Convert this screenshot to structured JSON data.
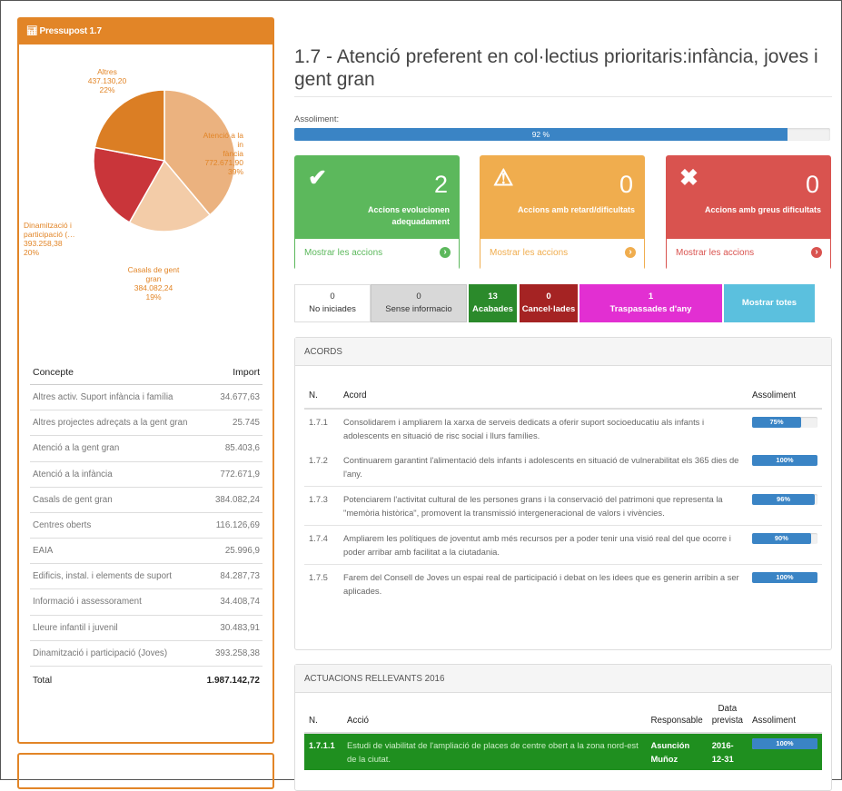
{
  "left_panel": {
    "header_icon": "bar-chart-icon",
    "header_title": "Pressupost 1.7",
    "colors": {
      "accent": "#e28527"
    },
    "pie_labels": [
      {
        "lines": [
          "Altres",
          "437.130,20",
          "22%"
        ]
      },
      {
        "lines": [
          "Atenció a la",
          "in",
          "fància",
          "772.671,90",
          "39%"
        ]
      },
      {
        "lines": [
          "Casals de gent",
          "gran",
          "384.082,24",
          "19%"
        ]
      },
      {
        "lines": [
          "Dinamització i",
          "participació (…",
          "393.258,38",
          "20%"
        ]
      }
    ],
    "table": {
      "col_concept": "Concepte",
      "col_import": "Import",
      "rows": [
        {
          "concept": "Altres activ. Suport infància i família",
          "import": "34.677,63"
        },
        {
          "concept": "Altres projectes adreçats a la gent gran",
          "import": "25.745"
        },
        {
          "concept": "Atenció a la gent gran",
          "import": "85.403,6"
        },
        {
          "concept": "Atenció a la infància",
          "import": "772.671,9"
        },
        {
          "concept": "Casals de gent gran",
          "import": "384.082,24"
        },
        {
          "concept": "Centres oberts",
          "import": "116.126,69"
        },
        {
          "concept": "EAIA",
          "import": "25.996,9"
        },
        {
          "concept": "Edificis, instal. i elements de suport",
          "import": "84.287,73"
        },
        {
          "concept": "Informació i assessorament",
          "import": "34.408,74"
        },
        {
          "concept": "Lleure infantil i juvenil",
          "import": "30.483,91"
        },
        {
          "concept": "Dinamització i participació (Joves)",
          "import": "393.258,38"
        }
      ],
      "total_label": "Total",
      "total_value": "1.987.142,72"
    }
  },
  "chart_data": {
    "type": "pie",
    "categories": [
      "Atenció a la infància",
      "Casals de gent gran",
      "Dinamització i participació (…)",
      "Altres"
    ],
    "values": [
      772671.9,
      384082.24,
      393258.38,
      437130.2
    ],
    "percent_labels": [
      "39%",
      "19%",
      "20%",
      "22%"
    ],
    "colors": [
      "#ebb27f",
      "#f3cca8",
      "#c9353a",
      "#db7e24"
    ]
  },
  "main": {
    "title": "1.7 - Atenció preferent en col·lectius prioritaris:infància, joves i gent gran",
    "assoliment_label": "Assoliment:",
    "assoliment_percent": 92,
    "assoliment_text": "92 %",
    "cards": [
      {
        "icon": "check-icon",
        "count": "2",
        "text": "Accions evolucionen adequadament",
        "link": "Mostrar les accions"
      },
      {
        "icon": "warning-icon",
        "count": "0",
        "text": "Accions amb retard/dificultats",
        "link": "Mostrar les accions"
      },
      {
        "icon": "close-icon",
        "count": "0",
        "text": "Accions amb greus dificultats",
        "link": "Mostrar les accions"
      }
    ],
    "filters": [
      {
        "count": "0",
        "label": "No iniciades"
      },
      {
        "count": "0",
        "label": "Sense informacio"
      },
      {
        "count": "13",
        "label": "Acabades"
      },
      {
        "count": "0",
        "label": "Cancel·lades"
      },
      {
        "count": "1",
        "label": "Traspassades d'any"
      },
      {
        "label": "Mostrar totes"
      }
    ],
    "acords": {
      "title": "ACORDS",
      "col_n": "N.",
      "col_acord": "Acord",
      "col_assoliment": "Assoliment",
      "rows": [
        {
          "n": "1.7.1",
          "text": "Consolidarem i ampliarem la xarxa de serveis dedicats a oferir suport socioeducatiu als infants i adolescents en situació de risc social i llurs famílies.",
          "percent": 75,
          "label": "75%"
        },
        {
          "n": "1.7.2",
          "text": "Continuarem garantint l'alimentació dels infants i adolescents en situació de vulnerabilitat els 365 dies de l'any.",
          "percent": 100,
          "label": "100%"
        },
        {
          "n": "1.7.3",
          "text": "Potenciarem l'activitat cultural de les persones grans i la conservació del patrimoni que representa la \"memòria històrica\", promovent la transmissió intergeneracional de valors i vivències.",
          "percent": 96,
          "label": "96%"
        },
        {
          "n": "1.7.4",
          "text": "Ampliarem les polítiques de joventut amb més recursos per a poder tenir una visió real del que ocorre i poder arribar amb facilitat a la ciutadania.",
          "percent": 90,
          "label": "90%"
        },
        {
          "n": "1.7.5",
          "text": "Farem del Consell de Joves un espai real de participació i debat on les idees que es generin arribin a ser aplicades.",
          "percent": 100,
          "label": "100%"
        }
      ]
    },
    "actuacions": {
      "title": "ACTUACIONS RELLEVANTS 2016",
      "col_n": "N.",
      "col_accio": "Acció",
      "col_responsable": "Responsable",
      "col_data": "Data prevista",
      "col_assoliment": "Assoliment",
      "rows": [
        {
          "n": "1.7.1.1",
          "text": "Estudi de viabilitat de l'ampliació de places de centre obert a la zona nord-est de la ciutat.",
          "responsable": "Asunción Muñoz",
          "data": "2016-12-31",
          "percent": 100,
          "label": "100%"
        }
      ]
    }
  }
}
